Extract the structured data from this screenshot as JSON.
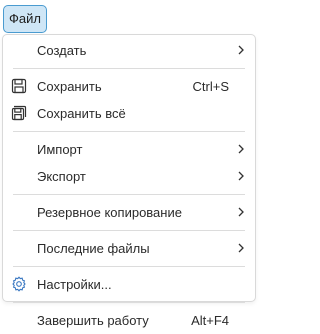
{
  "menubar": {
    "file_label": "Файл"
  },
  "menu": {
    "create": "Создать",
    "save": "Сохранить",
    "save_shortcut": "Ctrl+S",
    "save_all": "Сохранить всё",
    "import": "Импорт",
    "export": "Экспорт",
    "backup": "Резервное копирование",
    "recent": "Последние файлы",
    "settings": "Настройки...",
    "exit": "Завершить работу",
    "exit_shortcut": "Alt+F4"
  },
  "icons": {
    "save": "floppy-disk-icon",
    "save_all": "multiple-floppy-disks-icon",
    "settings": "gear-icon",
    "submenu": "chevron-right-icon"
  },
  "colors": {
    "active_button_bg": "#cfe6f6",
    "active_button_border": "#4a9bd0",
    "settings_icon": "#3a78c2"
  }
}
